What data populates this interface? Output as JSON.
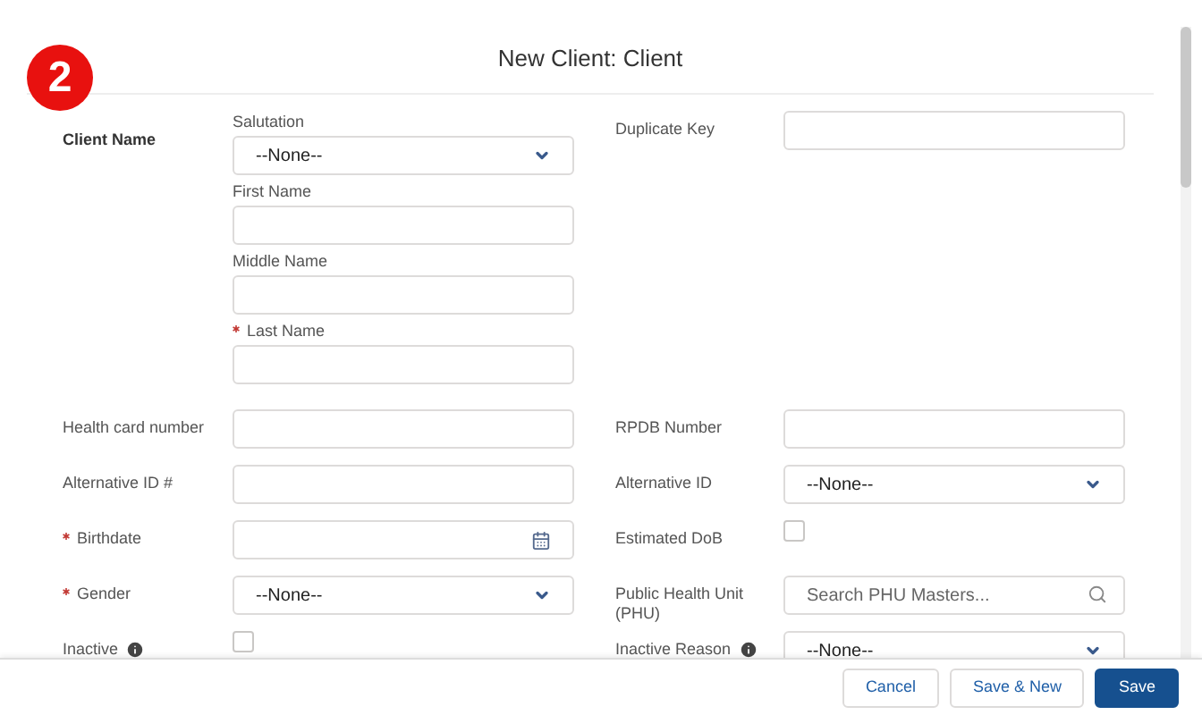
{
  "title": "New Client: Client",
  "badge": "2",
  "client_name": {
    "label": "Client Name",
    "fields": [
      {
        "kind": "select",
        "label": "Salutation",
        "required": false,
        "value": "--None--"
      },
      {
        "kind": "text",
        "label": "First Name",
        "required": false
      },
      {
        "kind": "text",
        "label": "Middle Name",
        "required": false
      },
      {
        "kind": "text",
        "label": "Last Name",
        "required": true
      }
    ]
  },
  "duplicate_key": {
    "kind": "text",
    "label": "Duplicate Key",
    "required": false
  },
  "rows": [
    {
      "left": {
        "kind": "text",
        "label": "Health card number",
        "required": false
      },
      "right": {
        "kind": "text",
        "label": "RPDB Number",
        "required": false
      }
    },
    {
      "left": {
        "kind": "text",
        "label": "Alternative ID #",
        "required": false
      },
      "right": {
        "kind": "select",
        "label": "Alternative ID",
        "required": false,
        "value": "--None--"
      }
    },
    {
      "left": {
        "kind": "date",
        "label": "Birthdate",
        "required": true
      },
      "right": {
        "kind": "checkbox",
        "label": "Estimated DoB",
        "required": false,
        "checked": false
      }
    },
    {
      "left": {
        "kind": "select",
        "label": "Gender",
        "required": true,
        "value": "--None--"
      },
      "right": {
        "kind": "lookup",
        "label": "Public Health Unit (PHU)",
        "required": false,
        "placeholder": "Search PHU Masters..."
      }
    },
    {
      "left": {
        "kind": "checkbox",
        "label": "Inactive",
        "required": false,
        "info": true,
        "checked": false
      },
      "right": {
        "kind": "select",
        "label": "Inactive Reason",
        "required": false,
        "info": true,
        "value": "--None--"
      }
    }
  ],
  "buttons": [
    {
      "label": "Cancel",
      "kind": "neutral"
    },
    {
      "label": "Save & New",
      "kind": "neutral"
    },
    {
      "label": "Save",
      "kind": "brand"
    }
  ]
}
